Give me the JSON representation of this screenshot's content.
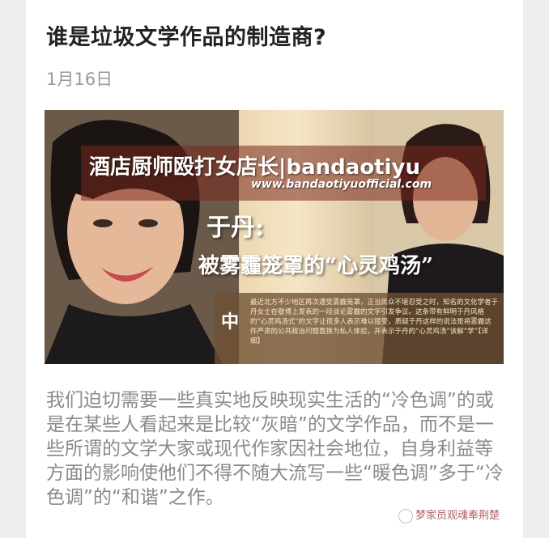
{
  "article": {
    "title": "谁是垃圾文学作品的制造商?",
    "date": "1月16日",
    "image": {
      "banner_text": "酒店厨师殴打女店长|bandaotiyu",
      "banner_url": "www.bandaotiyuofficial.com",
      "name_text": "于丹:",
      "headline_text": "被雾霾笼罩的“心灵鸡汤”",
      "news_logo": "中",
      "news_text": "最近北方不少地区再次遭受雾霾笼罩，正当民众不堪忍受之时，知名的文化学者于丹女士在敬博上发表的一段谈论雾霾的文字引发争议。这条带有鲜明于丹风格的“心灵鸡汤式”的文字让很多人表示难以接受，质疑于丹这样的说法是将雾霾这件严肃的公共政治问题置换为私人体验，并表示于丹的“心灵鸡汤”该解“学”【详细】"
    },
    "body": "我们迫切需要一些真实地反映现实生活的“冷色调”的或是在某些人看起来是比较“灰暗”的文学作品，而不是一些所谓的文学大家或现代作家因社会地位，自身利益等方面的影响使他们不得不随大流写一些“暖色调”多于“冷色调”的“和谐”之作。",
    "watermark": "梦家员观魂奉荆楚"
  }
}
